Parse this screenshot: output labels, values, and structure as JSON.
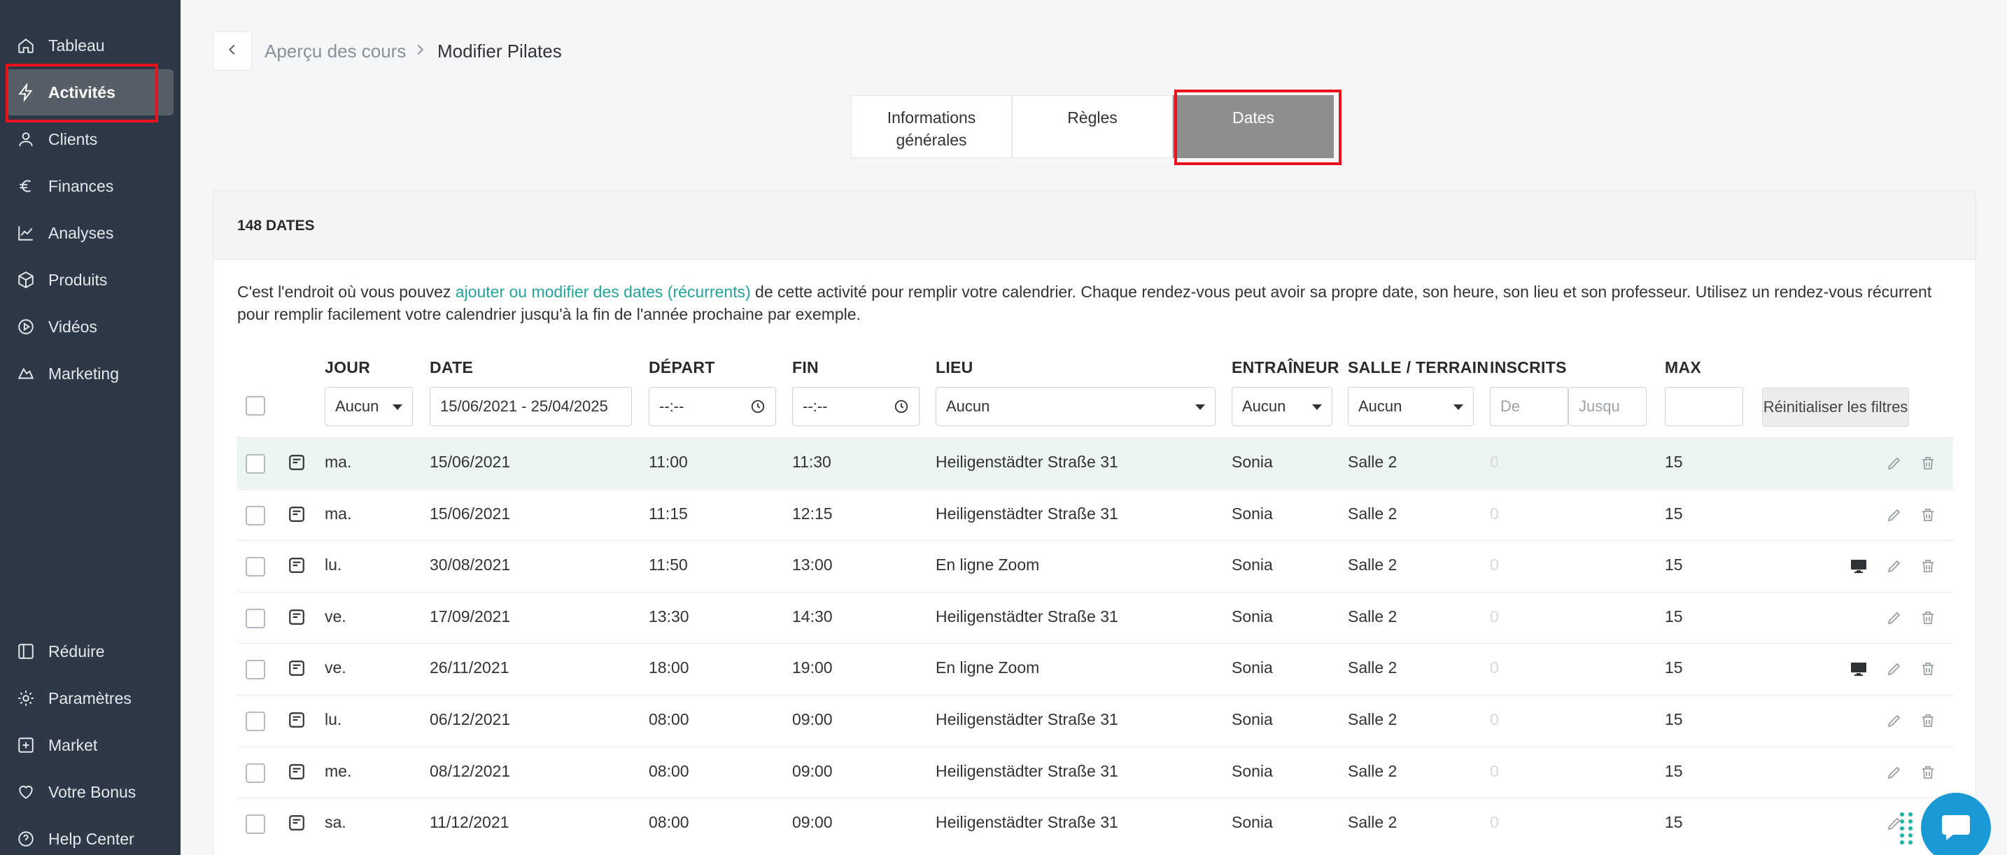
{
  "sidebar": {
    "items": [
      {
        "label": "Tableau",
        "icon": "home-icon"
      },
      {
        "label": "Activités",
        "icon": "lightning-icon"
      },
      {
        "label": "Clients",
        "icon": "user-icon"
      },
      {
        "label": "Finances",
        "icon": "euro-icon"
      },
      {
        "label": "Analyses",
        "icon": "chart-line-icon"
      },
      {
        "label": "Produits",
        "icon": "box-icon"
      },
      {
        "label": "Vidéos",
        "icon": "play-circle-icon"
      },
      {
        "label": "Marketing",
        "icon": "megaphone-icon"
      }
    ],
    "bottom_items": [
      {
        "label": "Réduire",
        "icon": "collapse-icon"
      },
      {
        "label": "Paramètres",
        "icon": "gear-icon"
      },
      {
        "label": "Market",
        "icon": "plus-square-icon"
      },
      {
        "label": "Votre Bonus",
        "icon": "heart-icon"
      },
      {
        "label": "Help Center",
        "icon": "help-circle-icon"
      }
    ],
    "active": "Activités"
  },
  "breadcrumb": {
    "parent": "Aperçu des cours",
    "separator": ">",
    "current": "Modifier Pilates"
  },
  "tabs": [
    {
      "label_line1": "Informations",
      "label_line2": "générales"
    },
    {
      "label_line1": "Règles",
      "label_line2": ""
    },
    {
      "label_line1": "Dates",
      "label_line2": ""
    }
  ],
  "card": {
    "count_label": "148 DATES",
    "desc_before": "C'est l'endroit où vous pouvez ",
    "desc_link": "ajouter ou modifier des dates (récurrents)",
    "desc_after": " de cette activité pour remplir votre calendrier. Chaque rendez-vous peut avoir sa propre date, son heure, son lieu et son professeur. Utilisez un rendez-vous récurrent pour remplir facilement votre calendrier jusqu'à la fin de l'année prochaine par exemple."
  },
  "table": {
    "headers": {
      "jour": "JOUR",
      "date": "DATE",
      "depart": "DÉPART",
      "fin": "FIN",
      "lieu": "LIEU",
      "entraineur": "ENTRAÎNEUR",
      "salle": "SALLE / TERRAIN",
      "inscrits": "INSCRITS",
      "max": "MAX"
    },
    "filters": {
      "jour": "Aucun",
      "date": "15/06/2021 - 25/04/2025",
      "depart": "--:--",
      "fin": "--:--",
      "lieu": "Aucun",
      "entraineur": "Aucun",
      "salle": "Aucun",
      "inscrits_from_placeholder": "De",
      "inscrits_to_placeholder": "Jusqu",
      "max": ""
    },
    "reset_label": "Réinitialiser les filtres",
    "rows": [
      {
        "jour": "ma.",
        "date": "15/06/2021",
        "depart": "11:00",
        "fin": "11:30",
        "lieu": "Heiligenstädter Straße 31",
        "entraineur": "Sonia",
        "salle": "Salle 2",
        "inscrits": "0",
        "max": "15",
        "online": false
      },
      {
        "jour": "ma.",
        "date": "15/06/2021",
        "depart": "11:15",
        "fin": "12:15",
        "lieu": "Heiligenstädter Straße 31",
        "entraineur": "Sonia",
        "salle": "Salle 2",
        "inscrits": "0",
        "max": "15",
        "online": false
      },
      {
        "jour": "lu.",
        "date": "30/08/2021",
        "depart": "11:50",
        "fin": "13:00",
        "lieu": "En ligne Zoom",
        "entraineur": "Sonia",
        "salle": "Salle 2",
        "inscrits": "0",
        "max": "15",
        "online": true
      },
      {
        "jour": "ve.",
        "date": "17/09/2021",
        "depart": "13:30",
        "fin": "14:30",
        "lieu": "Heiligenstädter Straße 31",
        "entraineur": "Sonia",
        "salle": "Salle 2",
        "inscrits": "0",
        "max": "15",
        "online": false
      },
      {
        "jour": "ve.",
        "date": "26/11/2021",
        "depart": "18:00",
        "fin": "19:00",
        "lieu": "En ligne Zoom",
        "entraineur": "Sonia",
        "salle": "Salle 2",
        "inscrits": "0",
        "max": "15",
        "online": true
      },
      {
        "jour": "lu.",
        "date": "06/12/2021",
        "depart": "08:00",
        "fin": "09:00",
        "lieu": "Heiligenstädter Straße 31",
        "entraineur": "Sonia",
        "salle": "Salle 2",
        "inscrits": "0",
        "max": "15",
        "online": false
      },
      {
        "jour": "me.",
        "date": "08/12/2021",
        "depart": "08:00",
        "fin": "09:00",
        "lieu": "Heiligenstädter Straße 31",
        "entraineur": "Sonia",
        "salle": "Salle 2",
        "inscrits": "0",
        "max": "15",
        "online": false
      },
      {
        "jour": "sa.",
        "date": "11/12/2021",
        "depart": "08:00",
        "fin": "09:00",
        "lieu": "Heiligenstädter Straße 31",
        "entraineur": "Sonia",
        "salle": "Salle 2",
        "inscrits": "0",
        "max": "15",
        "online": false
      }
    ]
  },
  "colors": {
    "sidebar_bg": "#2d3946",
    "accent": "#22a59a",
    "highlight": "#e8111c",
    "chat": "#1b98d6",
    "tab_active": "#8e8e8e"
  }
}
